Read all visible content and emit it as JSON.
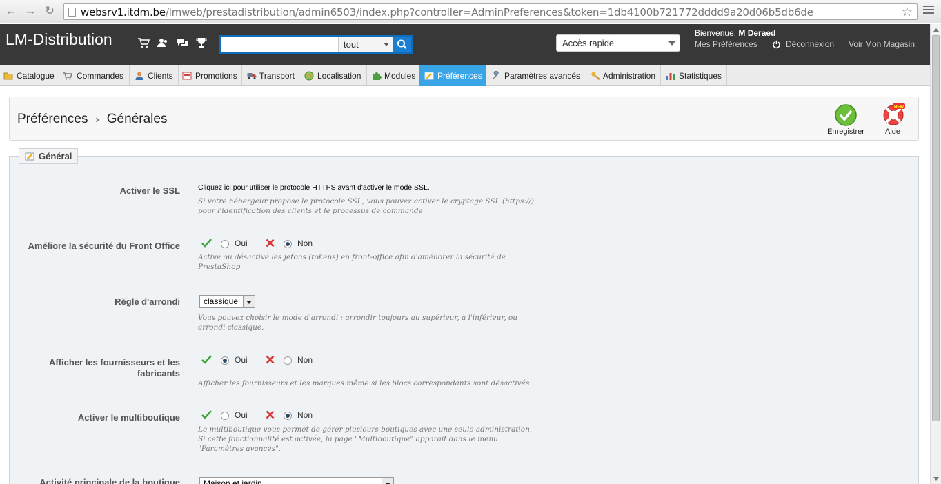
{
  "browser": {
    "url_host": "websrv1.itdm.be",
    "url_path": "/lmweb/prestadistribution/admin6503/index.php?controller=AdminPreferences&token=1db4100b721772dddd9a20d06b5db6de"
  },
  "header": {
    "shop_name": "LM-Distribution",
    "search_placeholder": "",
    "search_scope": "tout",
    "quick_access": "Accès rapide",
    "welcome_prefix": "Bienvenue,",
    "user_name": "M Deraed",
    "links": {
      "preferences": "Mes Préférences",
      "logout": "Déconnexion",
      "store": "Voir Mon Magasin"
    }
  },
  "tabs": [
    {
      "label": "Catalogue",
      "icon": "folder-icon"
    },
    {
      "label": "Commandes",
      "icon": "cart-icon"
    },
    {
      "label": "Clients",
      "icon": "user-icon"
    },
    {
      "label": "Promotions",
      "icon": "tag-icon"
    },
    {
      "label": "Transport",
      "icon": "truck-icon"
    },
    {
      "label": "Localisation",
      "icon": "globe-icon"
    },
    {
      "label": "Modules",
      "icon": "puzzle-icon"
    },
    {
      "label": "Préférences",
      "icon": "preferences-icon",
      "active": true
    },
    {
      "label": "Paramètres avancés",
      "icon": "wrench-icon"
    },
    {
      "label": "Administration",
      "icon": "key-icon"
    },
    {
      "label": "Statistiques",
      "icon": "chart-icon"
    }
  ],
  "toolbar": {
    "breadcrumb_parent": "Préférences",
    "breadcrumb_current": "Générales",
    "save_label": "Enregistrer",
    "help_label": "Aide",
    "help_badge": "NEW"
  },
  "section": {
    "legend": "Général",
    "ssl": {
      "label": "Activer le SSL",
      "note": "Cliquez ici pour utiliser le protocole HTTPS avant d'activer le mode SSL.",
      "desc1": "Si votre hébergeur propose le protocole SSL, vous pouvez activer le cryptage SSL (https://)",
      "desc2": "pour l'identification des clients et le processus de commande"
    },
    "security": {
      "label": "Améliore la sécurité du Front Office",
      "yes": "Oui",
      "no": "Non",
      "value": "no",
      "desc1": "Active ou désactive les jetons (tokens) en front-office afin d'améliorer la sécurité de",
      "desc2": "PrestaShop"
    },
    "rounding": {
      "label": "Règle d'arrondi",
      "value": "classique",
      "desc1": "Vous pouvez choisir le mode d'arrondi : arrondir toujours au supérieur, à l'inférieur, ou",
      "desc2": "arrondi classique."
    },
    "suppliers": {
      "label1": "Afficher les fournisseurs et les",
      "label2": "fabricants",
      "yes": "Oui",
      "no": "Non",
      "value": "yes",
      "desc1": "Afficher les fournisseurs et les marques même si les blocs correspondants sont désactivés"
    },
    "multishop": {
      "label": "Activer le multiboutique",
      "yes": "Oui",
      "no": "Non",
      "value": "no",
      "desc1": "Le multiboutique vous permet de gérer plusieurs boutiques avec une seule administration.",
      "desc2": "Si cette fonctionnalité est activée, la page \"Multiboutique\" apparait dans le menu",
      "desc3": "\"Paramètres avancés\"."
    },
    "activity": {
      "label": "Activité principale de la boutique",
      "value": "Maison et jardin"
    }
  },
  "colors": {
    "header_bg": "#383838",
    "active_tab": "#3aa5e6",
    "search_btn": "#1a7fd3",
    "check": "#3fa33a",
    "cross": "#d63a3a"
  }
}
